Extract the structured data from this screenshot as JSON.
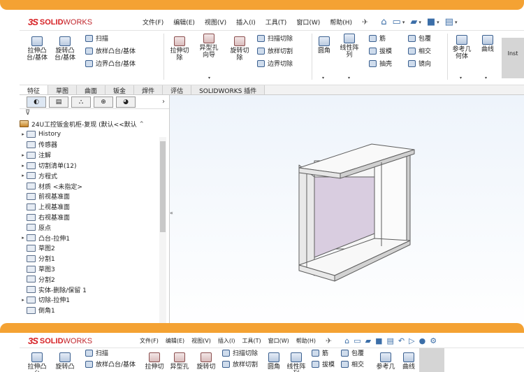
{
  "app": {
    "logo_ds": "3S",
    "logo_solid": "SOLID",
    "logo_works": "WORKS",
    "menus": [
      "文件(F)",
      "编辑(E)",
      "视图(V)",
      "插入(I)",
      "工具(T)",
      "窗口(W)",
      "帮助(H)"
    ],
    "menus_small": [
      "文件(F)",
      "编辑(E)",
      "视图(V)",
      "插入(I)",
      "工具(T)",
      "窗口(W)",
      "帮助(H)"
    ]
  },
  "ribbon": {
    "extrude_boss": "拉伸凸台/基体",
    "revolve_boss": "旋转凸台/基体",
    "sweep": "扫描",
    "loft": "放样凸台/基体",
    "boundary_boss": "边界凸台/基体",
    "extrude_cut": "拉伸切除",
    "hole_wizard": "异型孔向导",
    "revolve_cut": "旋转切除",
    "swept_cut": "扫描切除",
    "lofted_cut": "放样切割",
    "boundary_cut": "边界切除",
    "fillet": "圆角",
    "linear_pattern": "线性阵列",
    "rib": "筋",
    "draft": "拔模",
    "shell": "抽壳",
    "wrap": "包覆",
    "intersect": "相交",
    "mirror": "镜向",
    "ref_geometry": "参考几何体",
    "curves": "曲线",
    "instant3d": "Inst"
  },
  "tabs": [
    "特征",
    "草图",
    "曲面",
    "钣金",
    "焊件",
    "评估",
    "SOLIDWORKS 插件"
  ],
  "feature_tree": {
    "root": "24U工控钣金机柜-复现 (默认<<默认",
    "items": [
      {
        "label": "History",
        "expand": "▸"
      },
      {
        "label": "传感器",
        "expand": ""
      },
      {
        "label": "注解",
        "expand": "▸"
      },
      {
        "label": "切割清单(12)",
        "expand": "▸"
      },
      {
        "label": "方程式",
        "expand": "▸"
      },
      {
        "label": "材质 <未指定>",
        "expand": ""
      },
      {
        "label": "前视基准面",
        "expand": ""
      },
      {
        "label": "上视基准面",
        "expand": ""
      },
      {
        "label": "右视基准面",
        "expand": ""
      },
      {
        "label": "原点",
        "expand": ""
      },
      {
        "label": "凸台-拉伸1",
        "expand": "▸"
      },
      {
        "label": "草图2",
        "expand": ""
      },
      {
        "label": "分割1",
        "expand": ""
      },
      {
        "label": "草图3",
        "expand": ""
      },
      {
        "label": "分割2",
        "expand": ""
      },
      {
        "label": "实体-删除/保留 1",
        "expand": ""
      },
      {
        "label": "切除-拉伸1",
        "expand": "▸"
      },
      {
        "label": "倒角1",
        "expand": ""
      }
    ]
  },
  "second": {
    "ribbon_sweep": "扫描",
    "ribbon_swept_cut": "扫描切除",
    "ribbon_rib": "筋",
    "ribbon_wrap": "包覆",
    "extrude_boss": "拉伸凸台",
    "revolve_boss": "旋转凸",
    "loft": "放样凸台/基体",
    "extrude_cut": "拉伸切",
    "hole_wizard": "异型孔",
    "revolve_cut": "旋转切",
    "lofted_cut": "放样切割",
    "fillet": "圆角",
    "linear_pattern": "线性阵列",
    "draft": "拔模",
    "intersect": "相交",
    "ref_geometry": "参考几",
    "curves": "曲线"
  },
  "colors": {
    "accent": "#f4a233",
    "logo": "#d62024",
    "panel_inner": "#d9cde0"
  }
}
